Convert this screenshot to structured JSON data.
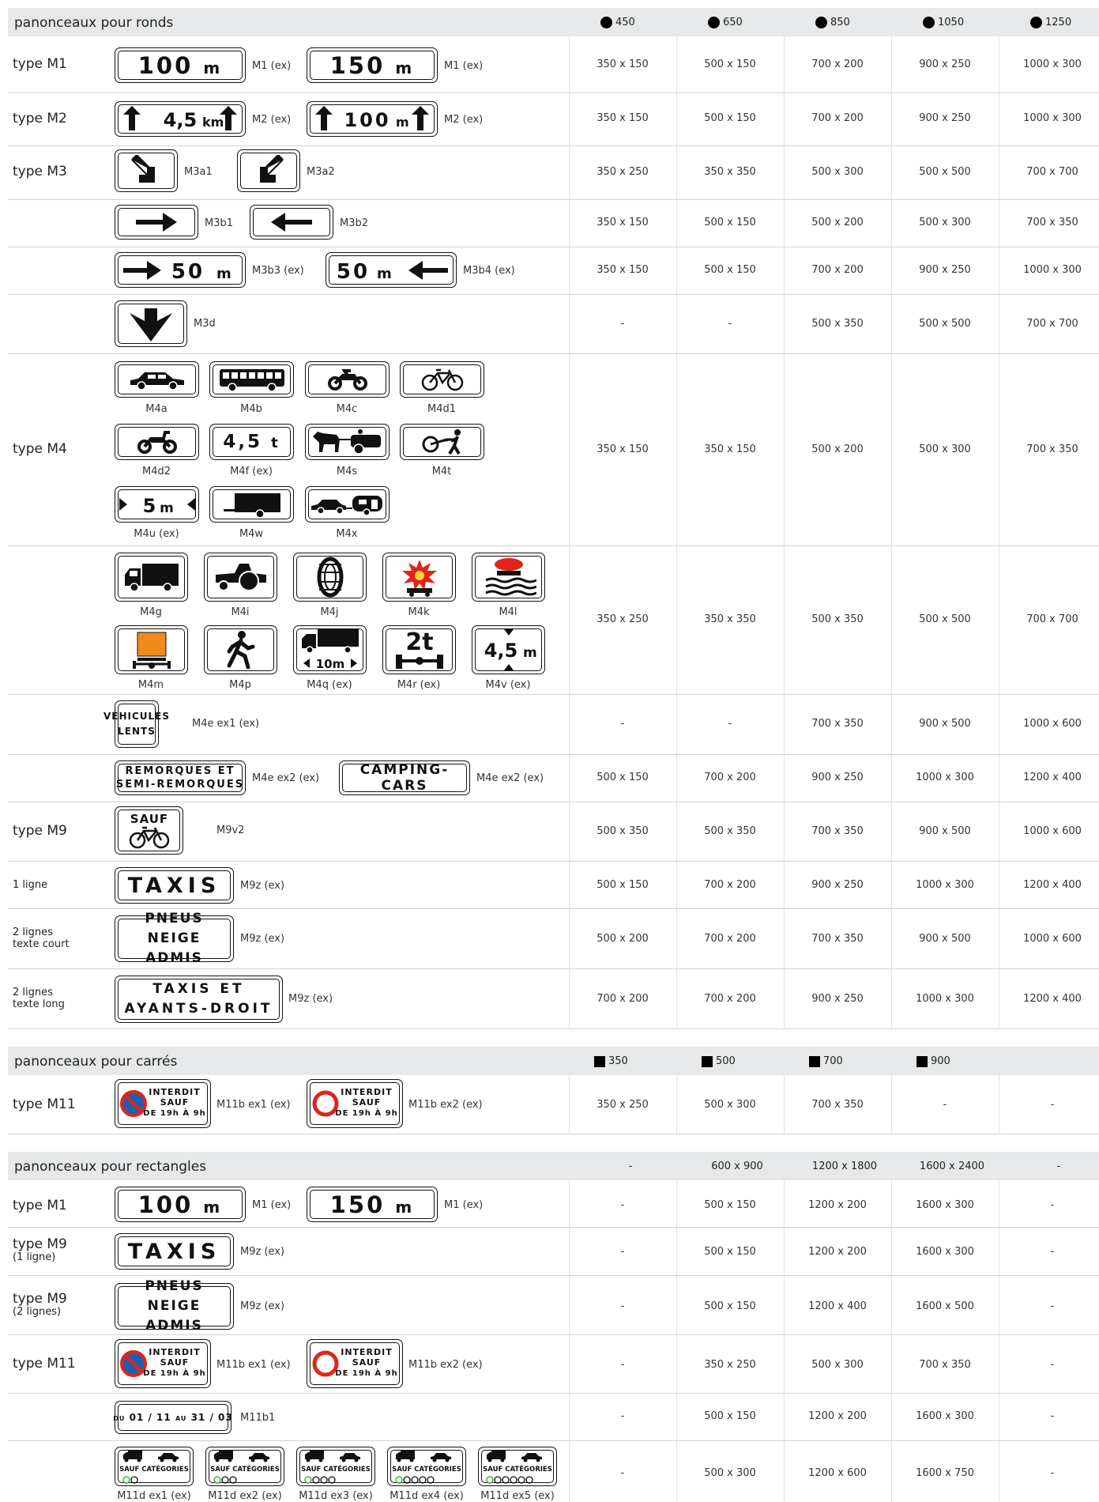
{
  "sections": {
    "ronds": {
      "title": "panonceaux pour ronds",
      "cols": [
        "450",
        "650",
        "850",
        "1050",
        "1250"
      ]
    },
    "carres": {
      "title": "panonceaux pour carrés",
      "cols": [
        "350",
        "500",
        "700",
        "900"
      ]
    },
    "rectangles": {
      "title": "panonceaux pour rectangles",
      "cols": [
        "-",
        "600 x 900",
        "1200 x 1800",
        "1600 x 2400",
        "-"
      ]
    }
  },
  "labels": {
    "m1": "type M1",
    "m2": "type M2",
    "m3": "type M3",
    "m4": "type M4",
    "m9": "type M9",
    "ligne1": "1 ligne",
    "lignes2": "2 lignes",
    "texte_court": "texte court",
    "texte_long": "texte long",
    "m11": "type M11",
    "r_m1": "type M1",
    "r_m9a": "type M9",
    "r_m9a_sub": "(1 ligne)",
    "r_m9b": "type M9",
    "r_m9b_sub": "(2 lignes)",
    "r_m11": "type M11"
  },
  "signs": {
    "s100": "100",
    "s150": "150",
    "unit_m": "m",
    "s45km": "4,5",
    "unit_km": "km",
    "s50": "50",
    "s5": "5",
    "s45t": "4,5",
    "unit_t": "t",
    "s10m": "10m",
    "s2t": "2t",
    "s45m": "4,5",
    "vehicules": "VÉHICULES",
    "lents": "LENTS",
    "remorques": "REMORQUES ET",
    "semi": "SEMI-REMORQUES",
    "camping": "CAMPING-CARS",
    "sauf": "SAUF",
    "taxis": "TAXIS",
    "pneus": "PNEUS NEIGE",
    "admis": "ADMIS",
    "taxis_et": "TAXIS ET",
    "ayants": "AYANTS-DROIT",
    "interdit": "INTERDIT",
    "sauf2": "SAUF",
    "de19": "DE 19h À 9h",
    "du": "DU",
    "d1": "01 / 11",
    "au": "AU",
    "d2": "31 / 03",
    "sauf_cat": "SAUF CATÉGORIES"
  },
  "captions": {
    "m1ex": "M1 (ex)",
    "m2ex": "M2 (ex)",
    "m3a1": "M3a1",
    "m3a2": "M3a2",
    "m3b1": "M3b1",
    "m3b2": "M3b2",
    "m3b3": "M3b3 (ex)",
    "m3b4": "M3b4 (ex)",
    "m3d": "M3d",
    "m4a": "M4a",
    "m4b": "M4b",
    "m4c": "M4c",
    "m4d1": "M4d1",
    "m4d2": "M4d2",
    "m4f": "M4f (ex)",
    "m4s": "M4s",
    "m4t": "M4t",
    "m4u": "M4u (ex)",
    "m4w": "M4w",
    "m4x": "M4x",
    "m4g": "M4g",
    "m4i": "M4i",
    "m4j": "M4j",
    "m4k": "M4k",
    "m4l": "M4l",
    "m4m": "M4m",
    "m4p": "M4p",
    "m4q": "M4q (ex)",
    "m4r": "M4r (ex)",
    "m4v": "M4v (ex)",
    "m4eex1": "M4e ex1 (ex)",
    "m4eex2": "M4e ex2 (ex)",
    "m9v2": "M9v2",
    "m9z": "M9z (ex)",
    "m11bex1": "M11b ex1 (ex)",
    "m11bex2": "M11b ex2 (ex)",
    "m11b1": "M11b1",
    "m11d1": "M11d ex1 (ex)",
    "m11d2": "M11d ex2 (ex)",
    "m11d3": "M11d ex3 (ex)",
    "m11d4": "M11d ex4 (ex)",
    "m11d5": "M11d ex5 (ex)"
  },
  "values": {
    "r_m1": [
      "350 x 150",
      "500 x 150",
      "700 x 200",
      "900 x 250",
      "1000 x 300"
    ],
    "r_m2": [
      "350 x 150",
      "500 x 150",
      "700 x 200",
      "900 x 250",
      "1000 x 300"
    ],
    "r_m3a": [
      "350 x 250",
      "350 x 350",
      "500 x 300",
      "500 x 500",
      "700 x 700"
    ],
    "r_m3b": [
      "350 x 150",
      "500 x 150",
      "500 x 200",
      "500 x 300",
      "700 x 350"
    ],
    "r_m3b3": [
      "350 x 150",
      "500 x 150",
      "700 x 200",
      "900 x 250",
      "1000 x 300"
    ],
    "r_m3d": [
      "-",
      "-",
      "500 x 350",
      "500 x 500",
      "700 x 700"
    ],
    "r_m4a": [
      "350 x 150",
      "350 x 150",
      "500 x 200",
      "500 x 300",
      "700 x 350"
    ],
    "r_m4g": [
      "350 x 250",
      "350 x 350",
      "500 x 350",
      "500 x 500",
      "700 x 700"
    ],
    "r_m4e1": [
      "-",
      "-",
      "700 x 350",
      "900 x 500",
      "1000 x 600"
    ],
    "r_m4e2": [
      "500 x 150",
      "700 x 200",
      "900 x 250",
      "1000 x 300",
      "1200 x 400"
    ],
    "r_m9": [
      "500 x 350",
      "500 x 350",
      "700 x 350",
      "900 x 500",
      "1000 x 600"
    ],
    "r_1l": [
      "500 x 150",
      "700 x 200",
      "900 x 250",
      "1000 x 300",
      "1200 x 400"
    ],
    "r_2lc": [
      "500 x 200",
      "700 x 200",
      "700 x 350",
      "900 x 500",
      "1000 x 600"
    ],
    "r_2ll": [
      "700 x 200",
      "700 x 200",
      "900 x 250",
      "1000 x 300",
      "1200 x 400"
    ],
    "c_m11": [
      "350 x 250",
      "500 x 300",
      "700 x 350",
      "-",
      "-"
    ],
    "t_m1": [
      "-",
      "500 x 150",
      "1200 x 200",
      "1600 x 300",
      "-"
    ],
    "t_m9a": [
      "-",
      "500 x 150",
      "1200 x 200",
      "1600 x 300",
      "-"
    ],
    "t_m9b": [
      "-",
      "500 x 150",
      "1200 x 400",
      "1600 x 500",
      "-"
    ],
    "t_m11": [
      "-",
      "350 x 250",
      "500 x 300",
      "700 x 350",
      "-"
    ],
    "t_m11b1": [
      "-",
      "500 x 150",
      "1200 x 200",
      "1600 x 300",
      "-"
    ],
    "t_m11d": [
      "-",
      "500 x 300",
      "1200 x 600",
      "1600 x 750",
      "-"
    ]
  },
  "colors": {
    "blue": "#1f5fae",
    "red": "#e2231a",
    "orange": "#f08a1c",
    "green": "#4caf50",
    "header_bg": "#e6e8e9"
  }
}
